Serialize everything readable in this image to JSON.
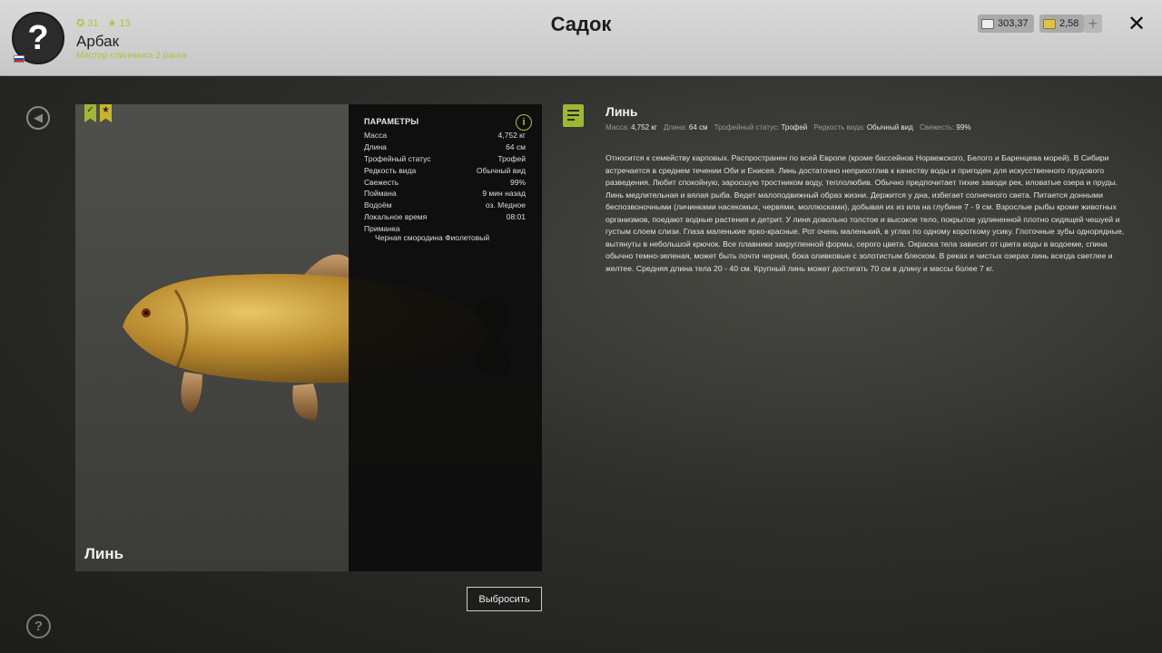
{
  "header": {
    "title": "Садок",
    "player": {
      "name": "Арбак",
      "rank": "Мастер спиннинга 2 ранга",
      "level": "31",
      "stars": "13"
    },
    "currency": {
      "credits": "303,37",
      "gold": "2,58"
    },
    "plus_label": "+",
    "close_label": "✕"
  },
  "fish_card": {
    "name": "Линь",
    "params_title": "ПАРАМЕТРЫ",
    "params": [
      {
        "label": "Масса",
        "value": "4,752 кг"
      },
      {
        "label": "Длина",
        "value": "64 см"
      },
      {
        "label": "Трофейный статус",
        "value": "Трофей"
      },
      {
        "label": "Редкость вида",
        "value": "Обычный вид"
      },
      {
        "label": "Свежесть",
        "value": "99%"
      },
      {
        "label": "Поймана",
        "value": "9 мин назад"
      },
      {
        "label": "Водоём",
        "value": "оз. Медное"
      },
      {
        "label": "Локальное время",
        "value": "08:01"
      }
    ],
    "bait_label": "Приманка",
    "bait_value": "Черная смородина Фиолетовый"
  },
  "release_button": "Выбросить",
  "description": {
    "name": "Линь",
    "meta": [
      {
        "label": "Масса:",
        "value": "4,752 кг"
      },
      {
        "label": "Длина:",
        "value": "64 см"
      },
      {
        "label": "Трофейный статус:",
        "value": "Трофей"
      },
      {
        "label": "Редкость вида:",
        "value": "Обычный вид"
      },
      {
        "label": "Свежесть:",
        "value": "99%"
      }
    ],
    "text": "Относится к семейству карповых. Распространен по всей Европе (кроме бассейнов Норвежского, Белого и Баренцева морей). В Сибири встречается в среднем течении Оби и Енисея. Линь достаточно неприхотлив к качеству воды и пригоден для искусственного прудового разведения. Любит спокойную, заросшую тростником воду, теплолюбив. Обычно предпочитает тихие заводи рек, иловатые озера и пруды. Линь медлительная и вялая рыба. Ведет малоподвижный образ жизни. Держится у дна, избегает солнечного света. Питается донными беспозвоночными (личинками насекомых, червями, моллюсками), добывая их из ила на глубине 7 - 9 см. Взрослые рыбы кроме животных организмов, поедают водные растения и детрит. У линя довольно толстое и высокое тело, покрытое удлиненной плотно сидящей чешуей и густым слоем слизи. Глаза маленькие ярко-красные. Рот очень маленький, в углах по одному короткому усику. Глоточные зубы однорядные, вытянуты в небольшой крючок. Все плавники закругленной формы, серого цвета. Окраска тела зависит от цвета воды в водоеме, спина обычно темно-зеленая, может быть почти черная, бока оливковые с золотистым блеском. В реках и чистых озерах линь всегда светлее и желтее. Средняя длина тела 20 - 40 см. Крупный линь может достигать 70 см в длину и массы более 7 кг."
  },
  "icons": {
    "avatar": "question-mark-icon",
    "back": "back-arrow-icon",
    "help": "help-icon",
    "info": "info-icon",
    "doc": "document-icon"
  },
  "colors": {
    "accent": "#9fb832",
    "topbar": "#d0d0d0"
  }
}
